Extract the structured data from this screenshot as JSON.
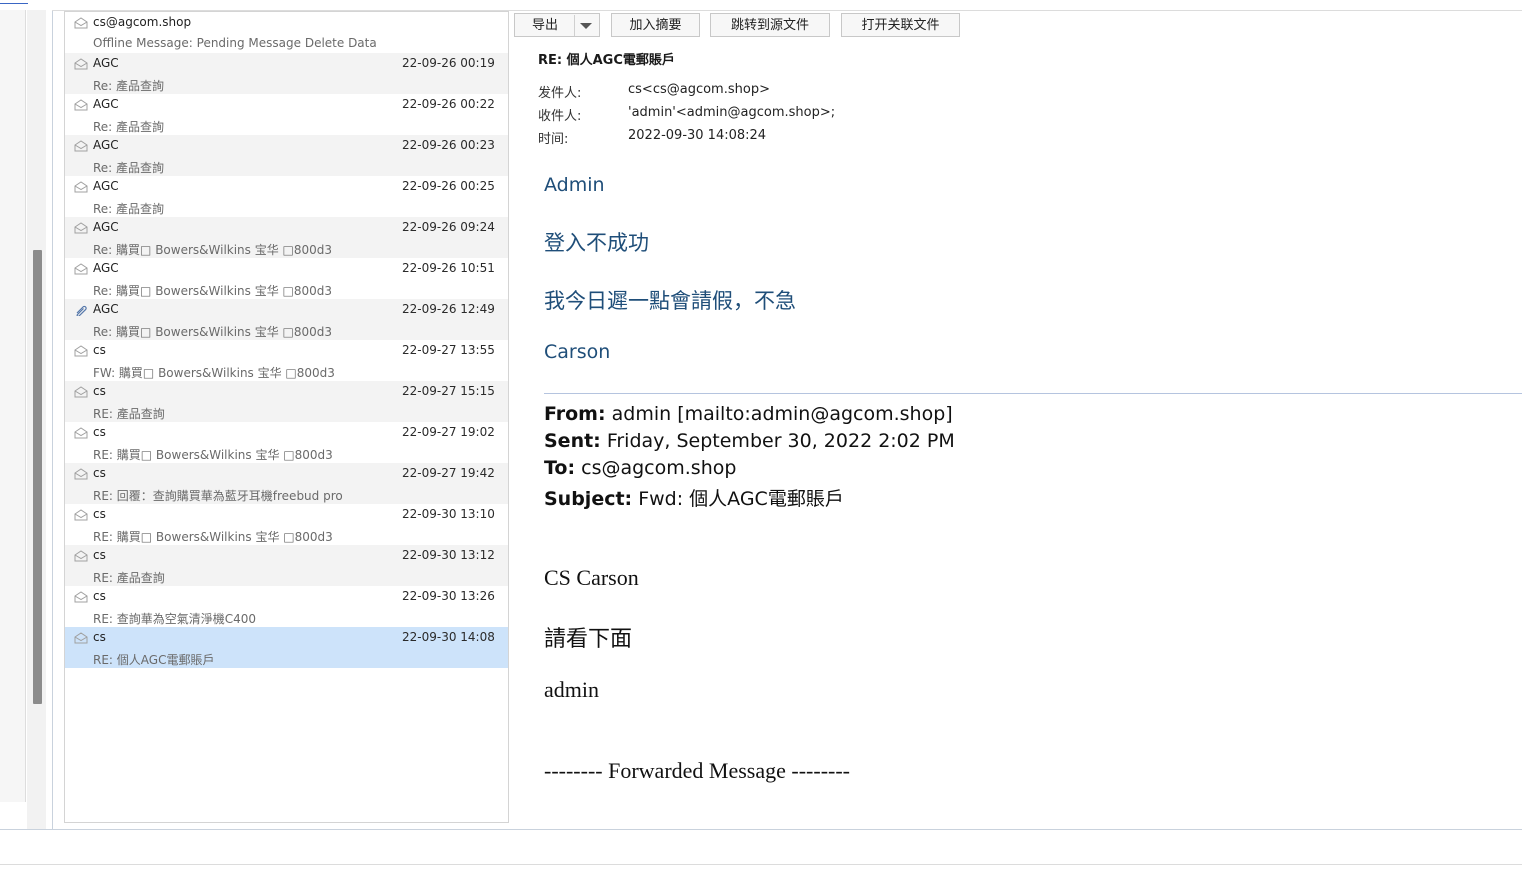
{
  "toolbar": {
    "export_label": "导出",
    "add_summary_label": "加入摘要",
    "jump_source_label": "跳转到源文件",
    "open_related_label": "打开关联文件"
  },
  "messages": [
    {
      "sender": "cs@agcom.shop",
      "date": "",
      "subject": "Offline Message: Pending Message Delete Data",
      "icon": "envelope-icon"
    },
    {
      "sender": "AGC",
      "date": "22-09-26 00:19",
      "subject": "Re: 產品查詢",
      "icon": "envelope-icon"
    },
    {
      "sender": "AGC",
      "date": "22-09-26 00:22",
      "subject": "Re: 產品查詢",
      "icon": "envelope-icon"
    },
    {
      "sender": "AGC",
      "date": "22-09-26 00:23",
      "subject": "Re: 產品查詢",
      "icon": "envelope-icon"
    },
    {
      "sender": "AGC",
      "date": "22-09-26 00:25",
      "subject": "Re: 產品查詢",
      "icon": "envelope-icon"
    },
    {
      "sender": "AGC",
      "date": "22-09-26 09:24",
      "subject": "Re: 購買□ Bowers&Wilkins 宝华 □800d3",
      "icon": "envelope-icon"
    },
    {
      "sender": "AGC",
      "date": "22-09-26 10:51",
      "subject": "Re: 購買□ Bowers&Wilkins 宝华 □800d3",
      "icon": "envelope-icon"
    },
    {
      "sender": "AGC",
      "date": "22-09-26 12:49",
      "subject": "Re: 購買□ Bowers&Wilkins 宝华 □800d3",
      "icon": "paperclip-icon"
    },
    {
      "sender": "cs",
      "date": "22-09-27 13:55",
      "subject": "FW: 購買□ Bowers&Wilkins 宝华 □800d3",
      "icon": "envelope-icon"
    },
    {
      "sender": "cs",
      "date": "22-09-27 15:15",
      "subject": "RE: 產品查詢",
      "icon": "envelope-icon"
    },
    {
      "sender": "cs",
      "date": "22-09-27 19:02",
      "subject": "RE: 購買□ Bowers&Wilkins 宝华 □800d3",
      "icon": "envelope-icon"
    },
    {
      "sender": "cs",
      "date": "22-09-27 19:42",
      "subject": "RE: 回覆：查詢購買華為藍牙耳機freebud pro",
      "icon": "envelope-icon"
    },
    {
      "sender": "cs",
      "date": "22-09-30 13:10",
      "subject": "RE: 購買□ Bowers&Wilkins 宝华 □800d3",
      "icon": "envelope-icon"
    },
    {
      "sender": "cs",
      "date": "22-09-30 13:12",
      "subject": "RE: 產品查詢",
      "icon": "envelope-icon"
    },
    {
      "sender": "cs",
      "date": "22-09-30 13:26",
      "subject": "RE: 查詢華為空氣清淨機C400",
      "icon": "envelope-icon"
    },
    {
      "sender": "cs",
      "date": "22-09-30 14:08",
      "subject": "RE: 個人AGC電郵賬戶",
      "icon": "envelope-icon",
      "selected": true
    }
  ],
  "email": {
    "subject": "RE: 個人AGC電郵賬戶",
    "from_label": "发件人:",
    "from_value": "cs<cs@agcom.shop>",
    "to_label": "收件人:",
    "to_value": "'admin'<admin@agcom.shop>;",
    "time_label": "时间:",
    "time_value": "2022-09-30 14:08:24",
    "body": {
      "greeting": "Admin",
      "line1": "登入不成功",
      "line2": "我今日遲一點會請假，不急",
      "signature": "Carson",
      "quoted": {
        "from_label": "From:",
        "from_value": " admin [mailto:admin@agcom.shop]",
        "sent_label": "Sent:",
        "sent_value": " Friday, September 30, 2022 2:02 PM",
        "to_label": "To:",
        "to_value": " cs@agcom.shop",
        "subject_label": "Subject:",
        "subject_value": " Fwd: 個人AGC電郵賬戶"
      },
      "quoted_greeting": "CS Carson",
      "quoted_line1": "請看下面",
      "quoted_signature": "admin",
      "forwarded_marker": "-------- Forwarded Message --------"
    }
  },
  "colors": {
    "selected_row": "#cde3fa",
    "alt_row": "#f3f3f3",
    "body_blue": "#1f4e79"
  }
}
